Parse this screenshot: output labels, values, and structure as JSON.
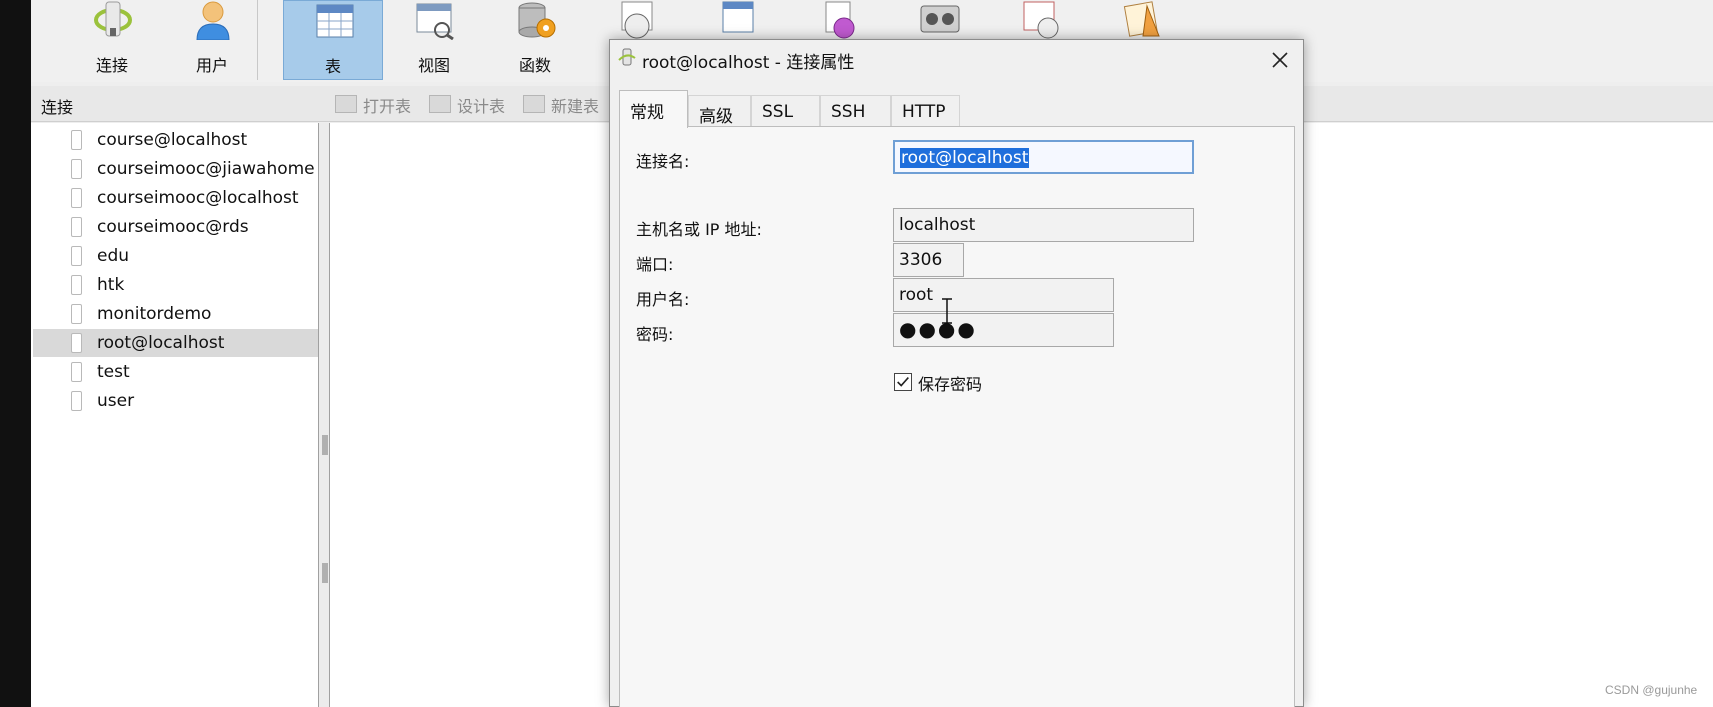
{
  "toolbar": {
    "connect_label": "连接",
    "user_label": "用户",
    "table_label": "表",
    "view_label": "视图",
    "function_label": "函数"
  },
  "subbar": {
    "connections_header": "连接",
    "open_table": "打开表",
    "design_table": "设计表",
    "new_table": "新建表"
  },
  "connections": [
    {
      "label": "course@localhost",
      "selected": false
    },
    {
      "label": "courseimooc@jiawahome",
      "selected": false
    },
    {
      "label": "courseimooc@localhost",
      "selected": false
    },
    {
      "label": "courseimooc@rds",
      "selected": false
    },
    {
      "label": "edu",
      "selected": false
    },
    {
      "label": "htk",
      "selected": false
    },
    {
      "label": "monitordemo",
      "selected": false
    },
    {
      "label": "root@localhost",
      "selected": true
    },
    {
      "label": "test",
      "selected": false
    },
    {
      "label": "user",
      "selected": false
    }
  ],
  "dialog": {
    "title": "root@localhost - 连接属性",
    "tabs": [
      "常规",
      "高级",
      "SSL",
      "SSH",
      "HTTP"
    ],
    "active_tab": "常规",
    "fields": {
      "name_label": "连接名:",
      "name_value": "root@localhost",
      "host_label": "主机名或 IP 地址:",
      "host_value": "localhost",
      "port_label": "端口:",
      "port_value": "3306",
      "user_label": "用户名:",
      "user_value": "root",
      "password_label": "密码:",
      "password_value": "●●●●"
    },
    "save_password_label": "保存密码",
    "save_password_checked": true
  },
  "watermark": "CSDN @gujunhe",
  "colors": {
    "selection": "#1f6fdc",
    "active_toolbar": "#a7cbea"
  }
}
